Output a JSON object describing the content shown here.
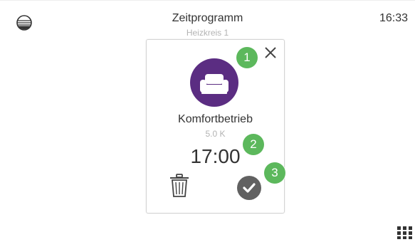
{
  "header": {
    "title": "Zeitprogramm",
    "subtitle": "Heizkreis 1",
    "clock": "16:33",
    "logo_icon": "brand-logo-icon"
  },
  "dialog": {
    "close_icon": "close-icon",
    "mode": {
      "icon": "armchair-icon",
      "icon_color": "#5b2d82",
      "name": "Komfortbetrieb",
      "value": "5.0 K"
    },
    "time": "17:00",
    "delete_icon": "trash-icon",
    "confirm_icon": "checkmark-icon",
    "confirm_color": "#616161"
  },
  "annotations": {
    "badge_color": "#5cb85c",
    "items": [
      "1",
      "2",
      "3"
    ]
  },
  "footer": {
    "menu_icon": "grid-menu-icon"
  }
}
